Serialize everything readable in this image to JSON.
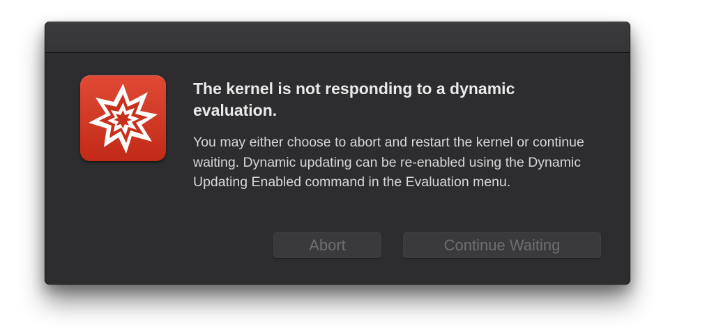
{
  "dialog": {
    "icon": "wolfram-mathematica-icon",
    "headline": "The kernel is not responding to a dynamic evaluation.",
    "message": "You may either choose to abort and restart the kernel or continue waiting.  Dynamic updating can be re-enabled using the Dynamic Updating Enabled command in the Evaluation menu.",
    "buttons": {
      "abort": "Abort",
      "continue": "Continue Waiting"
    }
  },
  "colors": {
    "dialog_background": "#2d2d2f",
    "icon_red": "#d13a24",
    "text_primary": "#e9e9ea",
    "button_disabled_text": "#6e6e71"
  }
}
